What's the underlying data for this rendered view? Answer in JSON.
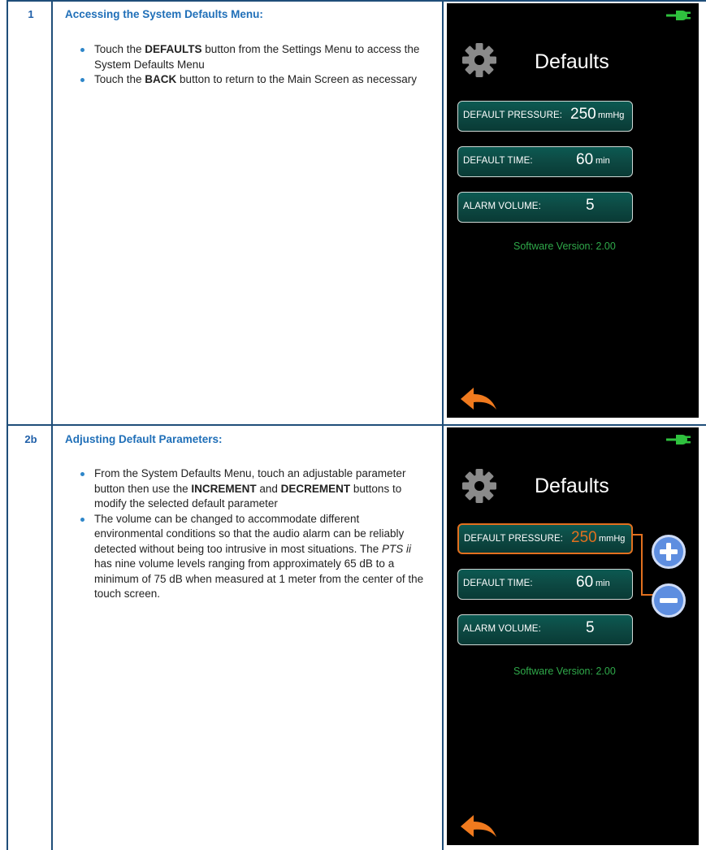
{
  "steps": [
    {
      "number": "1",
      "title": "Accessing the System Defaults Menu:",
      "bullets": [
        {
          "pre": "Touch the ",
          "bold": "DEFAULTS",
          "post": " button from the Settings Menu to access the System Defaults Menu"
        },
        {
          "pre": "Touch the ",
          "bold": "BACK",
          "post": " button to return to the Main Screen as necessary"
        }
      ],
      "screen": {
        "title": "Defaults",
        "params": [
          {
            "label": "DEFAULT PRESSURE:",
            "value": "250",
            "unit": "mmHg"
          },
          {
            "label": "DEFAULT TIME:",
            "value": "60",
            "unit": "min"
          },
          {
            "label": "ALARM VOLUME:",
            "value": "5",
            "unit": ""
          }
        ],
        "software_version": "Software Version: 2.00"
      }
    },
    {
      "number": "2b",
      "title": "Adjusting Default Parameters:",
      "bullet1": {
        "pre": "From the System Defaults Menu, touch an adjustable parameter button then use the ",
        "bold1": "INCREMENT",
        "mid": " and ",
        "bold2": "DECREMENT",
        "post": " buttons to modify the selected default parameter"
      },
      "bullet2": {
        "pre": "The volume can be changed to accommodate different environmental conditions so that the audio alarm can be reliably detected without being too intrusive in most situations. The ",
        "ital": "PTS ii",
        "post": " has nine volume levels ranging from approximately 65 dB to a minimum of 75 dB when measured at 1 meter from the center of the touch screen."
      },
      "screen": {
        "title": "Defaults",
        "params": [
          {
            "label": "DEFAULT PRESSURE:",
            "value": "250",
            "unit": "mmHg",
            "selected": true
          },
          {
            "label": "DEFAULT TIME:",
            "value": "60",
            "unit": "min"
          },
          {
            "label": "ALARM VOLUME:",
            "value": "5",
            "unit": ""
          }
        ],
        "software_version": "Software Version: 2.00"
      }
    }
  ],
  "colors": {
    "rule": "#1f4e79",
    "heading": "#1f6fb8",
    "button_fill": "#0d4a44",
    "selected_outline": "#e2701f",
    "version_text": "#2fa94a",
    "back_arrow": "#f07a1e",
    "plug": "#2fc13e",
    "round_button": "#5e8ee0"
  },
  "icons": [
    "plug-icon",
    "gear-icon",
    "back-arrow-icon",
    "increment-icon",
    "decrement-icon"
  ]
}
